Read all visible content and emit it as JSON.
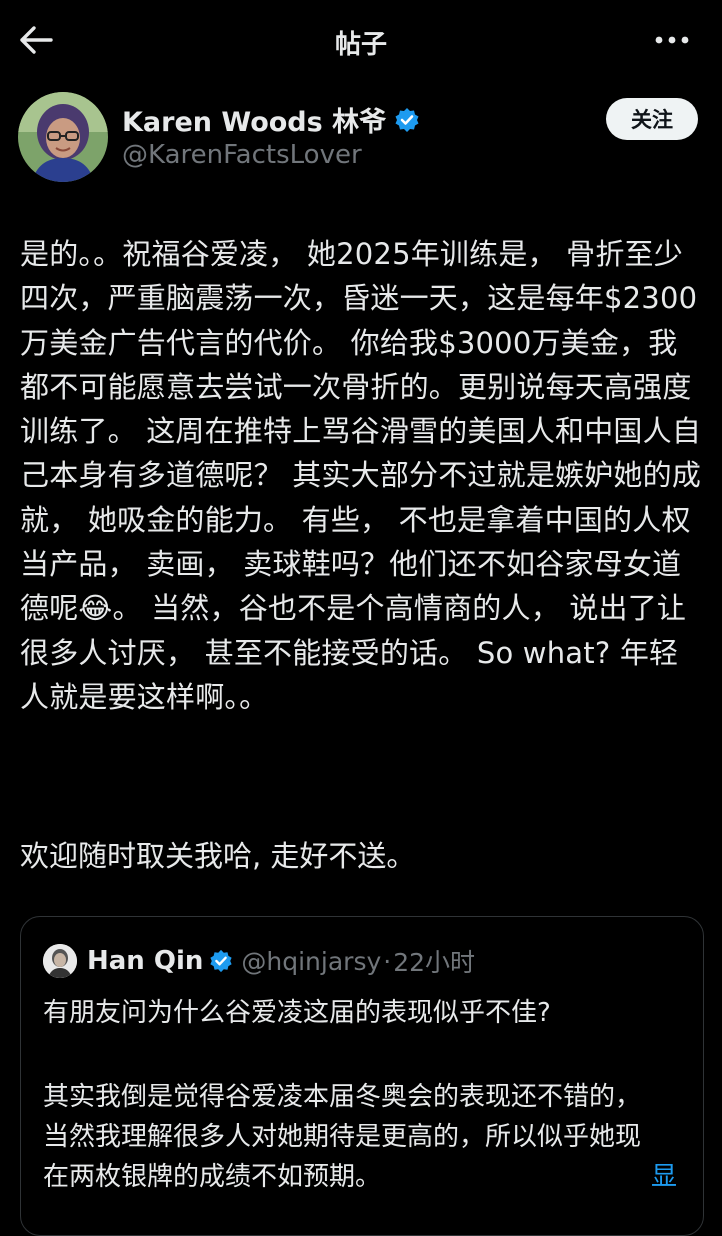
{
  "header": {
    "title": "帖子",
    "back_icon": "arrow-left-icon",
    "more_icon": "more-horizontal-icon"
  },
  "author": {
    "name": "Karen Woods 林爷",
    "handle": "@KarenFactsLover",
    "verified": true,
    "follow_label": "关注"
  },
  "post": {
    "body": "是的。。祝福谷爱凌， 她2025年训练是， 骨折至少四次，严重脑震荡一次，昏迷一天，这是每年$2300万美金广告代言的代价。 你给我$3000万美金，我都不可能愿意去尝试一次骨折的。更别说每天高强度训练了。 这周在推特上骂谷滑雪的美国人和中国人自己本身有多道德呢？ 其实大部分不过就是嫉妒她的成就， 她吸金的能力。 有些， 不也是拿着中国的人权当产品， 卖画， 卖球鞋吗？他们还不如谷家母女道德呢😂。 当然，谷也不是个高情商的人， 说出了让很多人讨厌， 甚至不能接受的话。 So what? 年轻人就是要这样啊。。",
    "footer": "欢迎随时取关我哈, 走好不送。"
  },
  "quote": {
    "name": "Han Qin",
    "verified": true,
    "handle": "@hqinjarsy",
    "separator": "·",
    "time": "22小时",
    "line1": "有朋友问为什么谷爱凌这届的表现似乎不佳?",
    "body": "其实我倒是觉得谷爱凌本届冬奥会的表现还不错的，当然我理解很多人对她期待是更高的，所以似乎她现在两枚银牌的成绩不如预期。",
    "show_more": "显"
  },
  "colors": {
    "background": "#000000",
    "text": "#e7e9ea",
    "secondary_text": "#71767b",
    "accent": "#1d9bf0",
    "border": "#2f3336"
  }
}
